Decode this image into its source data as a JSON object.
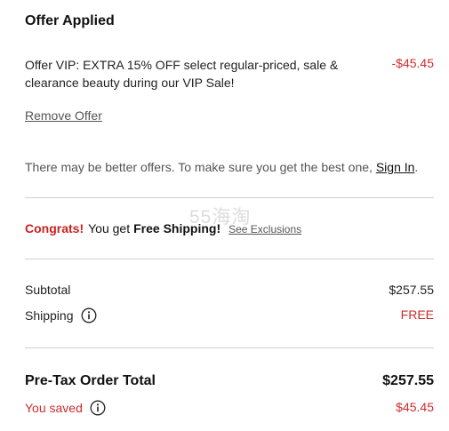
{
  "offer": {
    "title": "Offer Applied",
    "description": "Offer VIP: EXTRA 15% OFF select regular-priced, sale & clearance beauty during our VIP Sale!",
    "amount": "-$45.45",
    "remove_label": "Remove Offer"
  },
  "notice": {
    "text": "There may be better offers. To make sure you get the best one, ",
    "link": "Sign In",
    "suffix": "."
  },
  "shipping_banner": {
    "congrats": "Congrats!",
    "text": "You get",
    "highlight": "Free Shipping!",
    "link": "See Exclusions"
  },
  "watermark": "55海淘",
  "summary": {
    "subtotal_label": "Subtotal",
    "subtotal_value": "$257.55",
    "shipping_label": "Shipping",
    "shipping_value": "FREE",
    "total_label": "Pre-Tax Order Total",
    "total_value": "$257.55",
    "saved_label": "You saved",
    "saved_value": "$45.45"
  },
  "colors": {
    "accent_red": "#cc2d2d",
    "divider": "#cfcfcf"
  },
  "icons": [
    "info-icon"
  ]
}
